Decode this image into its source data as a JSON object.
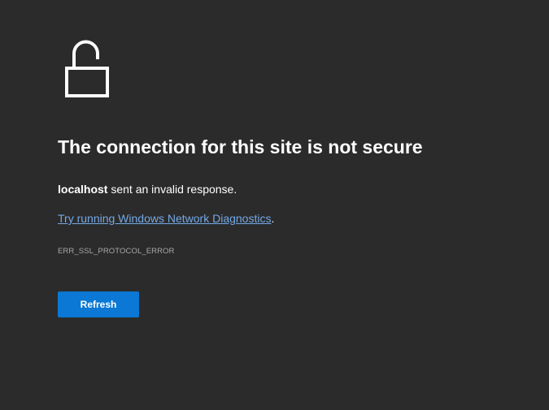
{
  "error_page": {
    "icon": "unlocked-padlock-icon",
    "title": "The connection for this site is not secure",
    "host": "localhost",
    "message_suffix": " sent an invalid response.",
    "diagnostics_link": "Try running Windows Network Diagnostics",
    "diagnostics_suffix": ".",
    "error_code": "ERR_SSL_PROTOCOL_ERROR",
    "refresh_label": "Refresh"
  },
  "colors": {
    "background": "#2b2b2b",
    "text": "#ffffff",
    "link": "#74a9e6",
    "error_code": "#a8a8a8",
    "button": "#0a78d4"
  }
}
